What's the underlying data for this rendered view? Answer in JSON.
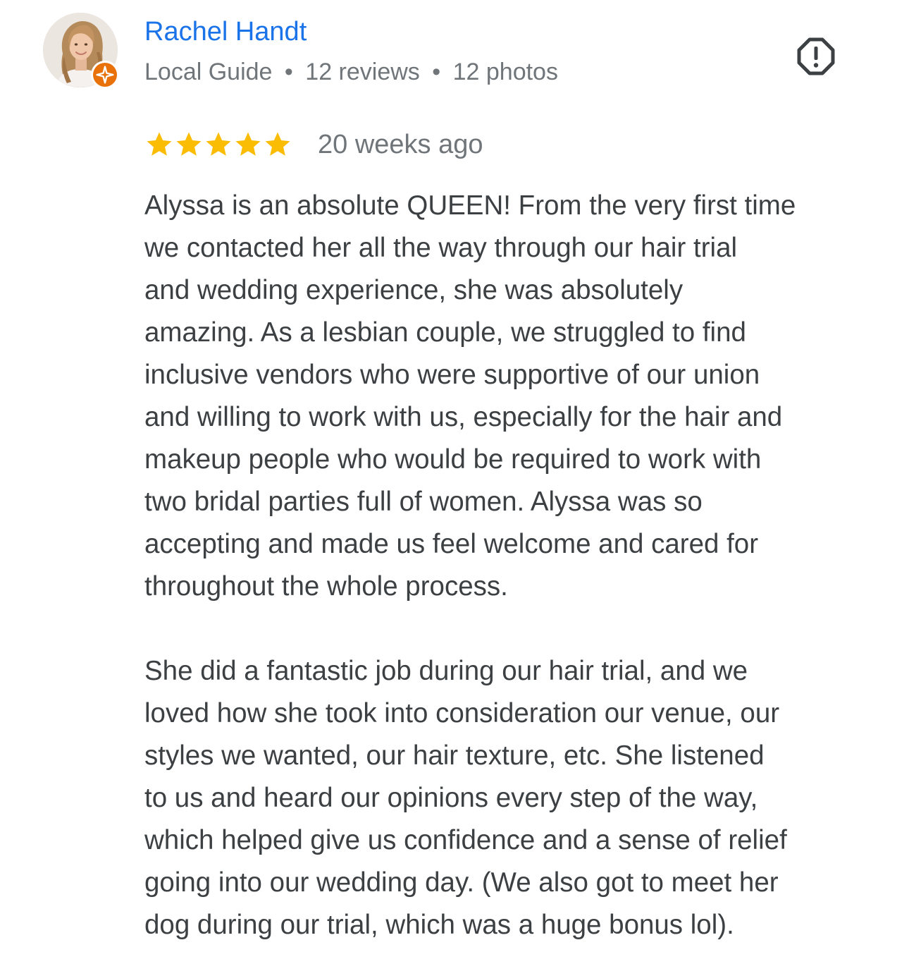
{
  "reviewer": {
    "name": "Rachel Handt",
    "badge": "Local Guide",
    "separator": "•",
    "reviews": "12 reviews",
    "photos": "12 photos",
    "avatar_icon": "user-photo",
    "badge_icon": "local-guide-star-icon"
  },
  "review": {
    "rating": 5,
    "rating_max": 5,
    "time_ago": "20 weeks ago",
    "paragraphs": [
      "Alyssa is an absolute QUEEN! From the very first time\nwe contacted her all the way through our hair trial\nand wedding experience, she was absolutely\namazing. As a lesbian couple, we struggled to find\ninclusive vendors who were supportive of our union\nand willing to work with us, especially for the hair and\nmakeup people who would be required to work with\ntwo bridal parties full of women. Alyssa was so\naccepting and made us feel welcome and cared for\nthroughout the whole process.",
      "She did a fantastic job during our hair trial, and we\nloved how she took into consideration our venue, our\nstyles we wanted, our hair texture, etc. She listened\nto us and heard our opinions every step of the way,\nwhich helped give us confidence and a sense of relief\ngoing into our wedding day. (We also got to meet her\ndog during our trial, which was a huge bonus lol)."
    ]
  },
  "actions": {
    "report_icon": "report-flag-icon"
  },
  "colors": {
    "name_link": "#1a73e8",
    "meta_text": "#70757a",
    "body_text": "#3c4043",
    "star": "#fbbc04",
    "badge": "#e8710a"
  }
}
